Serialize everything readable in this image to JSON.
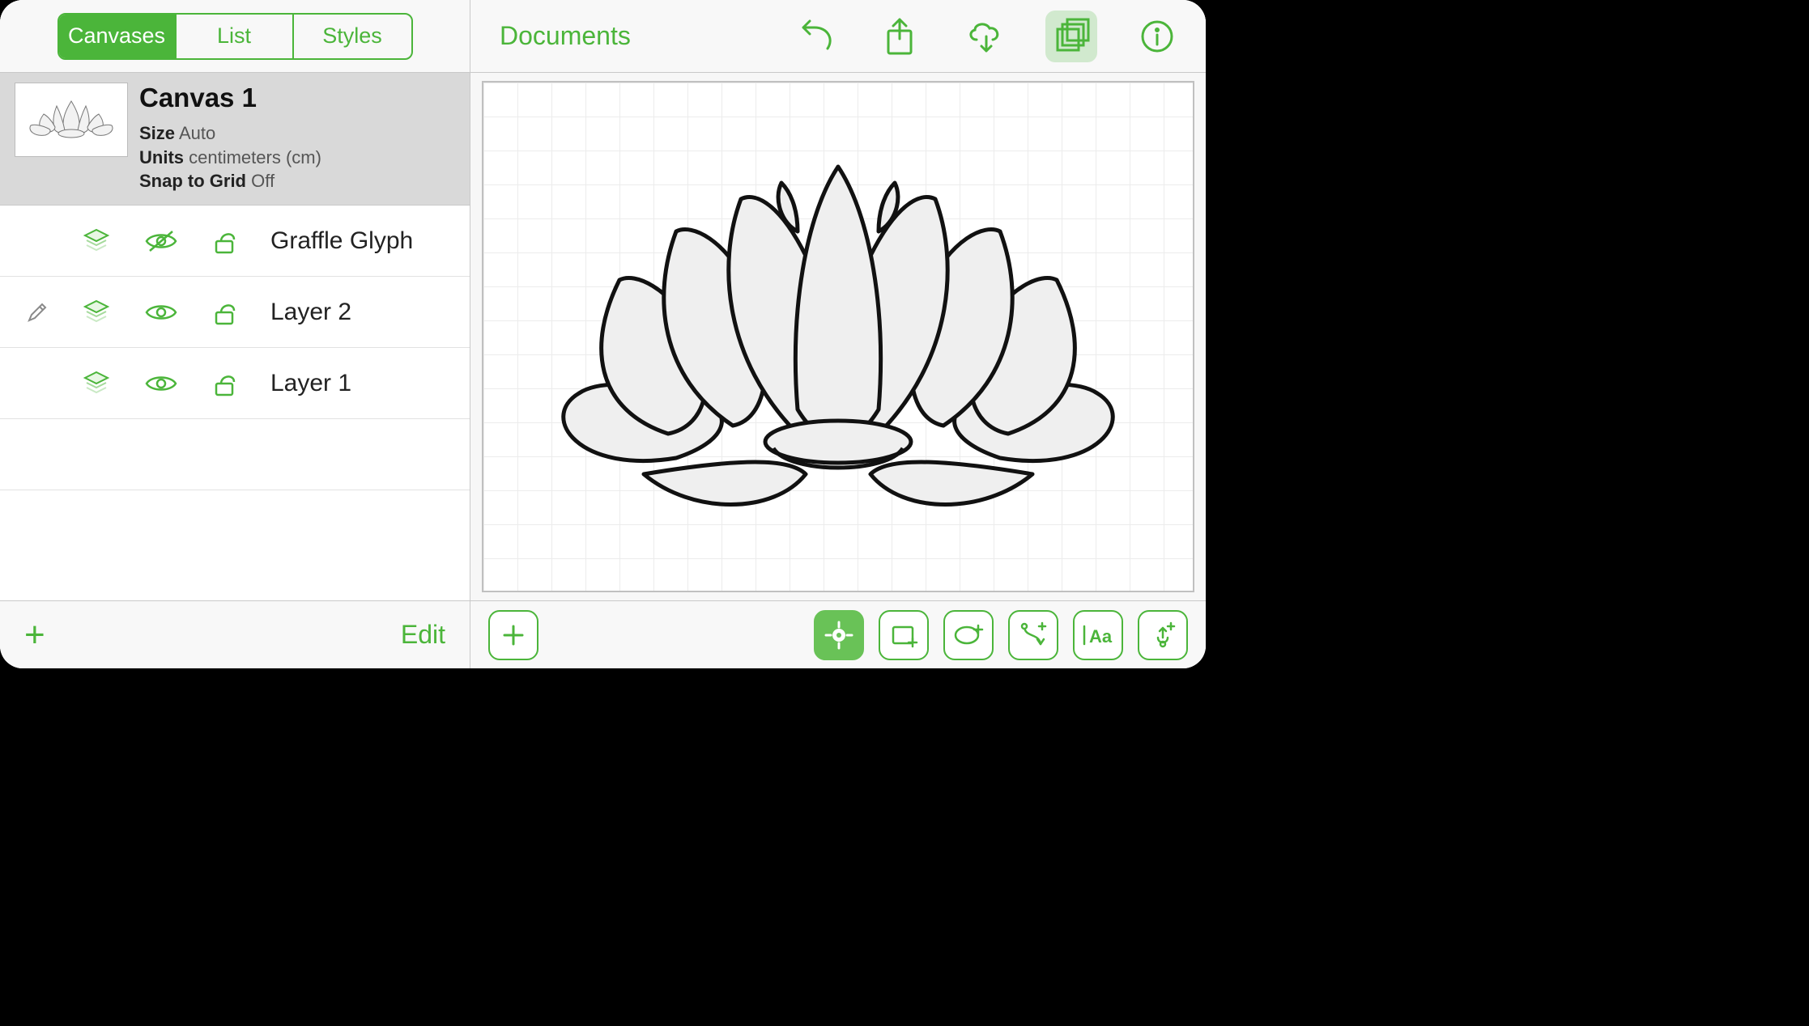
{
  "sidebar": {
    "tabs": [
      "Canvases",
      "List",
      "Styles"
    ],
    "active_tab": 0,
    "canvas": {
      "title": "Canvas 1",
      "size_label": "Size",
      "size_value": "Auto",
      "units_label": "Units",
      "units_value": "centimeters (cm)",
      "snap_label": "Snap to Grid",
      "snap_value": "Off"
    },
    "layers": [
      {
        "name": "Graffle Glyph",
        "editing": false,
        "visible": false,
        "locked": false
      },
      {
        "name": "Layer 2",
        "editing": true,
        "visible": true,
        "locked": false
      },
      {
        "name": "Layer 1",
        "editing": false,
        "visible": true,
        "locked": false
      }
    ],
    "add_label": "+",
    "edit_label": "Edit"
  },
  "toolbar": {
    "documents_label": "Documents",
    "icons": [
      "undo",
      "share",
      "sync",
      "canvases",
      "info"
    ],
    "active_icon": "canvases"
  },
  "bottom_tools": {
    "left": "add-shape",
    "tools": [
      "select",
      "rectangle",
      "ellipse",
      "line",
      "text",
      "freehand"
    ],
    "active": "select"
  },
  "colors": {
    "accent": "#4bb53a"
  }
}
